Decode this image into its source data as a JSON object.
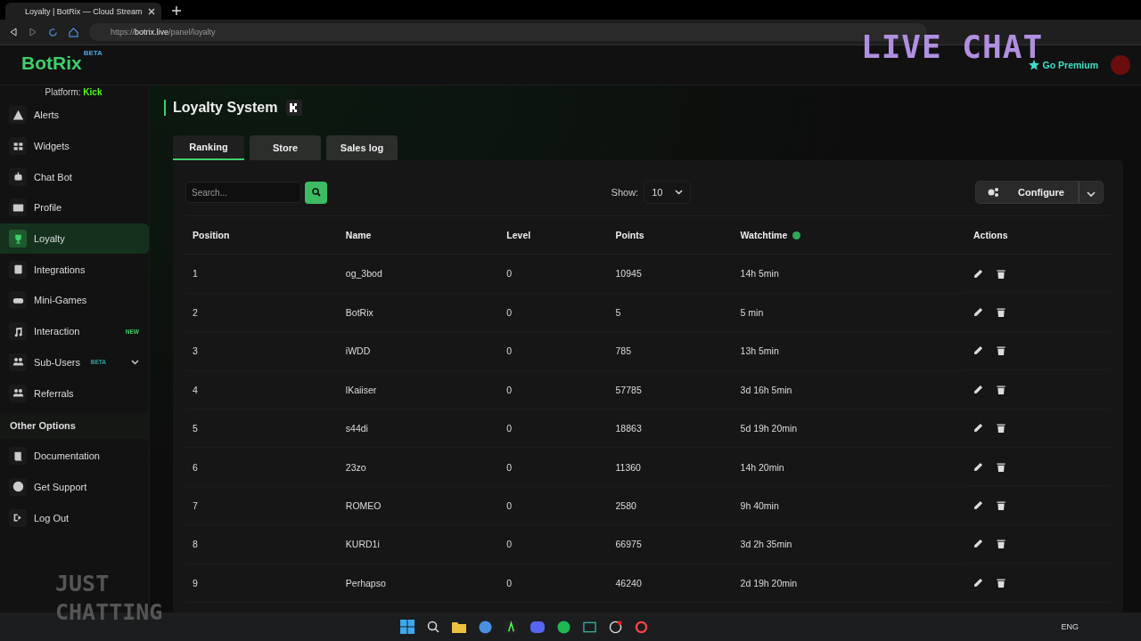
{
  "browser": {
    "tab_title": "Loyalty | BotRix — Cloud Stream",
    "url_scheme": "https://",
    "url_host": "botrix.live",
    "url_path": "/panel/loyalty"
  },
  "header": {
    "logo": "BotRix",
    "logo_badge": "BETA",
    "platform_label": "Platform:",
    "platform": "Kick",
    "premium": "Go Premium"
  },
  "sidebar": {
    "items": [
      {
        "label": "Alerts",
        "selected": false
      },
      {
        "label": "Widgets",
        "selected": false
      },
      {
        "label": "Chat Bot",
        "selected": false
      },
      {
        "label": "Profile",
        "selected": false
      },
      {
        "label": "Loyalty",
        "selected": true
      },
      {
        "label": "Integrations",
        "selected": false
      },
      {
        "label": "Mini-Games",
        "selected": false
      },
      {
        "label": "Interaction",
        "selected": false,
        "badge": "NEW"
      },
      {
        "label": "Sub-Users",
        "selected": false,
        "badge": "BETA",
        "expanded": false
      },
      {
        "label": "Referrals",
        "selected": false
      }
    ],
    "section": "Other Options",
    "other_items": [
      {
        "label": "Documentation",
        "selected": false
      },
      {
        "label": "Get Support",
        "selected": false
      },
      {
        "label": "Log Out",
        "selected": false
      }
    ]
  },
  "page": {
    "title": "Loyalty System",
    "tabs": [
      {
        "label": "Ranking",
        "selected": true
      },
      {
        "label": "Store",
        "selected": false
      },
      {
        "label": "Sales log",
        "selected": false
      }
    ],
    "search": {
      "placeholder": "Search..."
    },
    "show_label": "Show:",
    "show_value": "10",
    "configure": "Configure"
  },
  "table": {
    "columns": [
      "Position",
      "Name",
      "Level",
      "Points",
      "Watchtime",
      "Actions"
    ],
    "rows": [
      [
        "1",
        "og_3bod",
        "0",
        "10945",
        "14h 5min"
      ],
      [
        "2",
        "BotRix",
        "0",
        "5",
        "5 min"
      ],
      [
        "3",
        "iWDD",
        "0",
        "785",
        "13h 5min"
      ],
      [
        "4",
        "lKaiiser",
        "0",
        "57785",
        "3d 16h 5min"
      ],
      [
        "5",
        "s44di",
        "0",
        "18863",
        "5d 19h 20min"
      ],
      [
        "6",
        "23zo",
        "0",
        "11360",
        "14h 20min"
      ],
      [
        "7",
        "ROMEO",
        "0",
        "2580",
        "9h 40min"
      ],
      [
        "8",
        "KURD1i",
        "0",
        "66975",
        "3d 2h 35min"
      ],
      [
        "9",
        "Perhapso",
        "0",
        "46240",
        "2d 19h 20min"
      ]
    ]
  },
  "overlay": {
    "top": "LIVE CHAT",
    "bottom": "JUST CHATTING"
  },
  "taskbar": {
    "language": "ENG"
  }
}
